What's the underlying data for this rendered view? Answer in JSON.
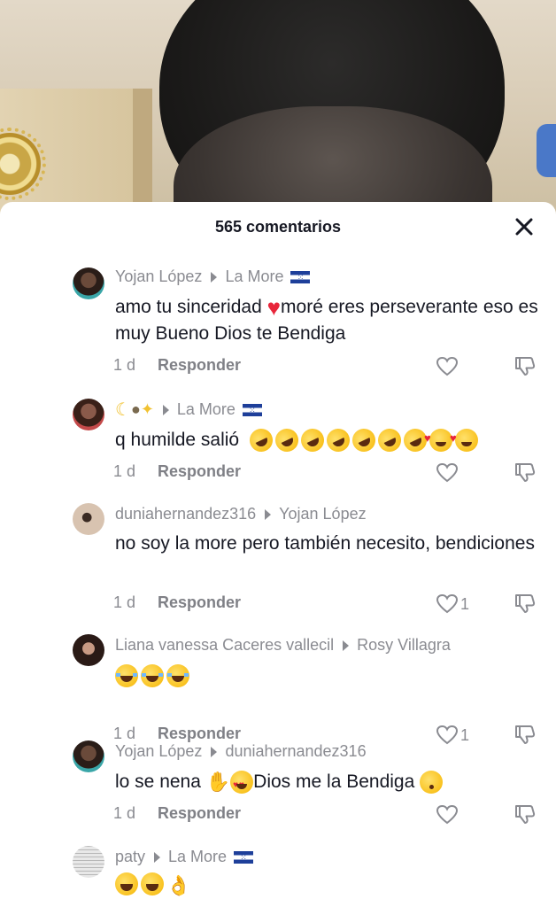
{
  "header": {
    "title": "565 comentarios"
  },
  "comments": [
    {
      "author": "Yojan López",
      "reply_to": "La More",
      "reply_to_flag": true,
      "text": "amo tu sinceridad",
      "text_after": "moré eres perseverante eso es muy Bueno Dios te Bendiga",
      "time": "1 d",
      "reply_label": "Responder",
      "likes": ""
    },
    {
      "author": "",
      "reply_to": "La More",
      "reply_to_flag": true,
      "text": "q humilde salió",
      "time": "1 d",
      "reply_label": "Responder",
      "likes": ""
    },
    {
      "author": "duniahernandez316",
      "reply_to": "Yojan López",
      "text": "no soy la more pero también necesito, bendiciones",
      "time": "1 d",
      "reply_label": "Responder",
      "likes": "1"
    },
    {
      "author": "Liana vanessa Caceres vallecil",
      "reply_to": "Rosy Villagra",
      "text": "",
      "time": "1 d",
      "reply_label": "Responder",
      "likes": "1"
    },
    {
      "author": "Yojan López",
      "reply_to": "duniahernandez316",
      "text": "lo se nena",
      "text_after": "Dios me la Bendiga",
      "time": "1 d",
      "reply_label": "Responder",
      "likes": ""
    },
    {
      "author": "paty",
      "reply_to": "La More",
      "reply_to_flag": true,
      "text": "",
      "time": "",
      "reply_label": "",
      "likes": ""
    }
  ],
  "colors": {
    "text_primary": "#161823",
    "text_secondary": "#8a8b91",
    "heart_red": "#e8253a"
  }
}
